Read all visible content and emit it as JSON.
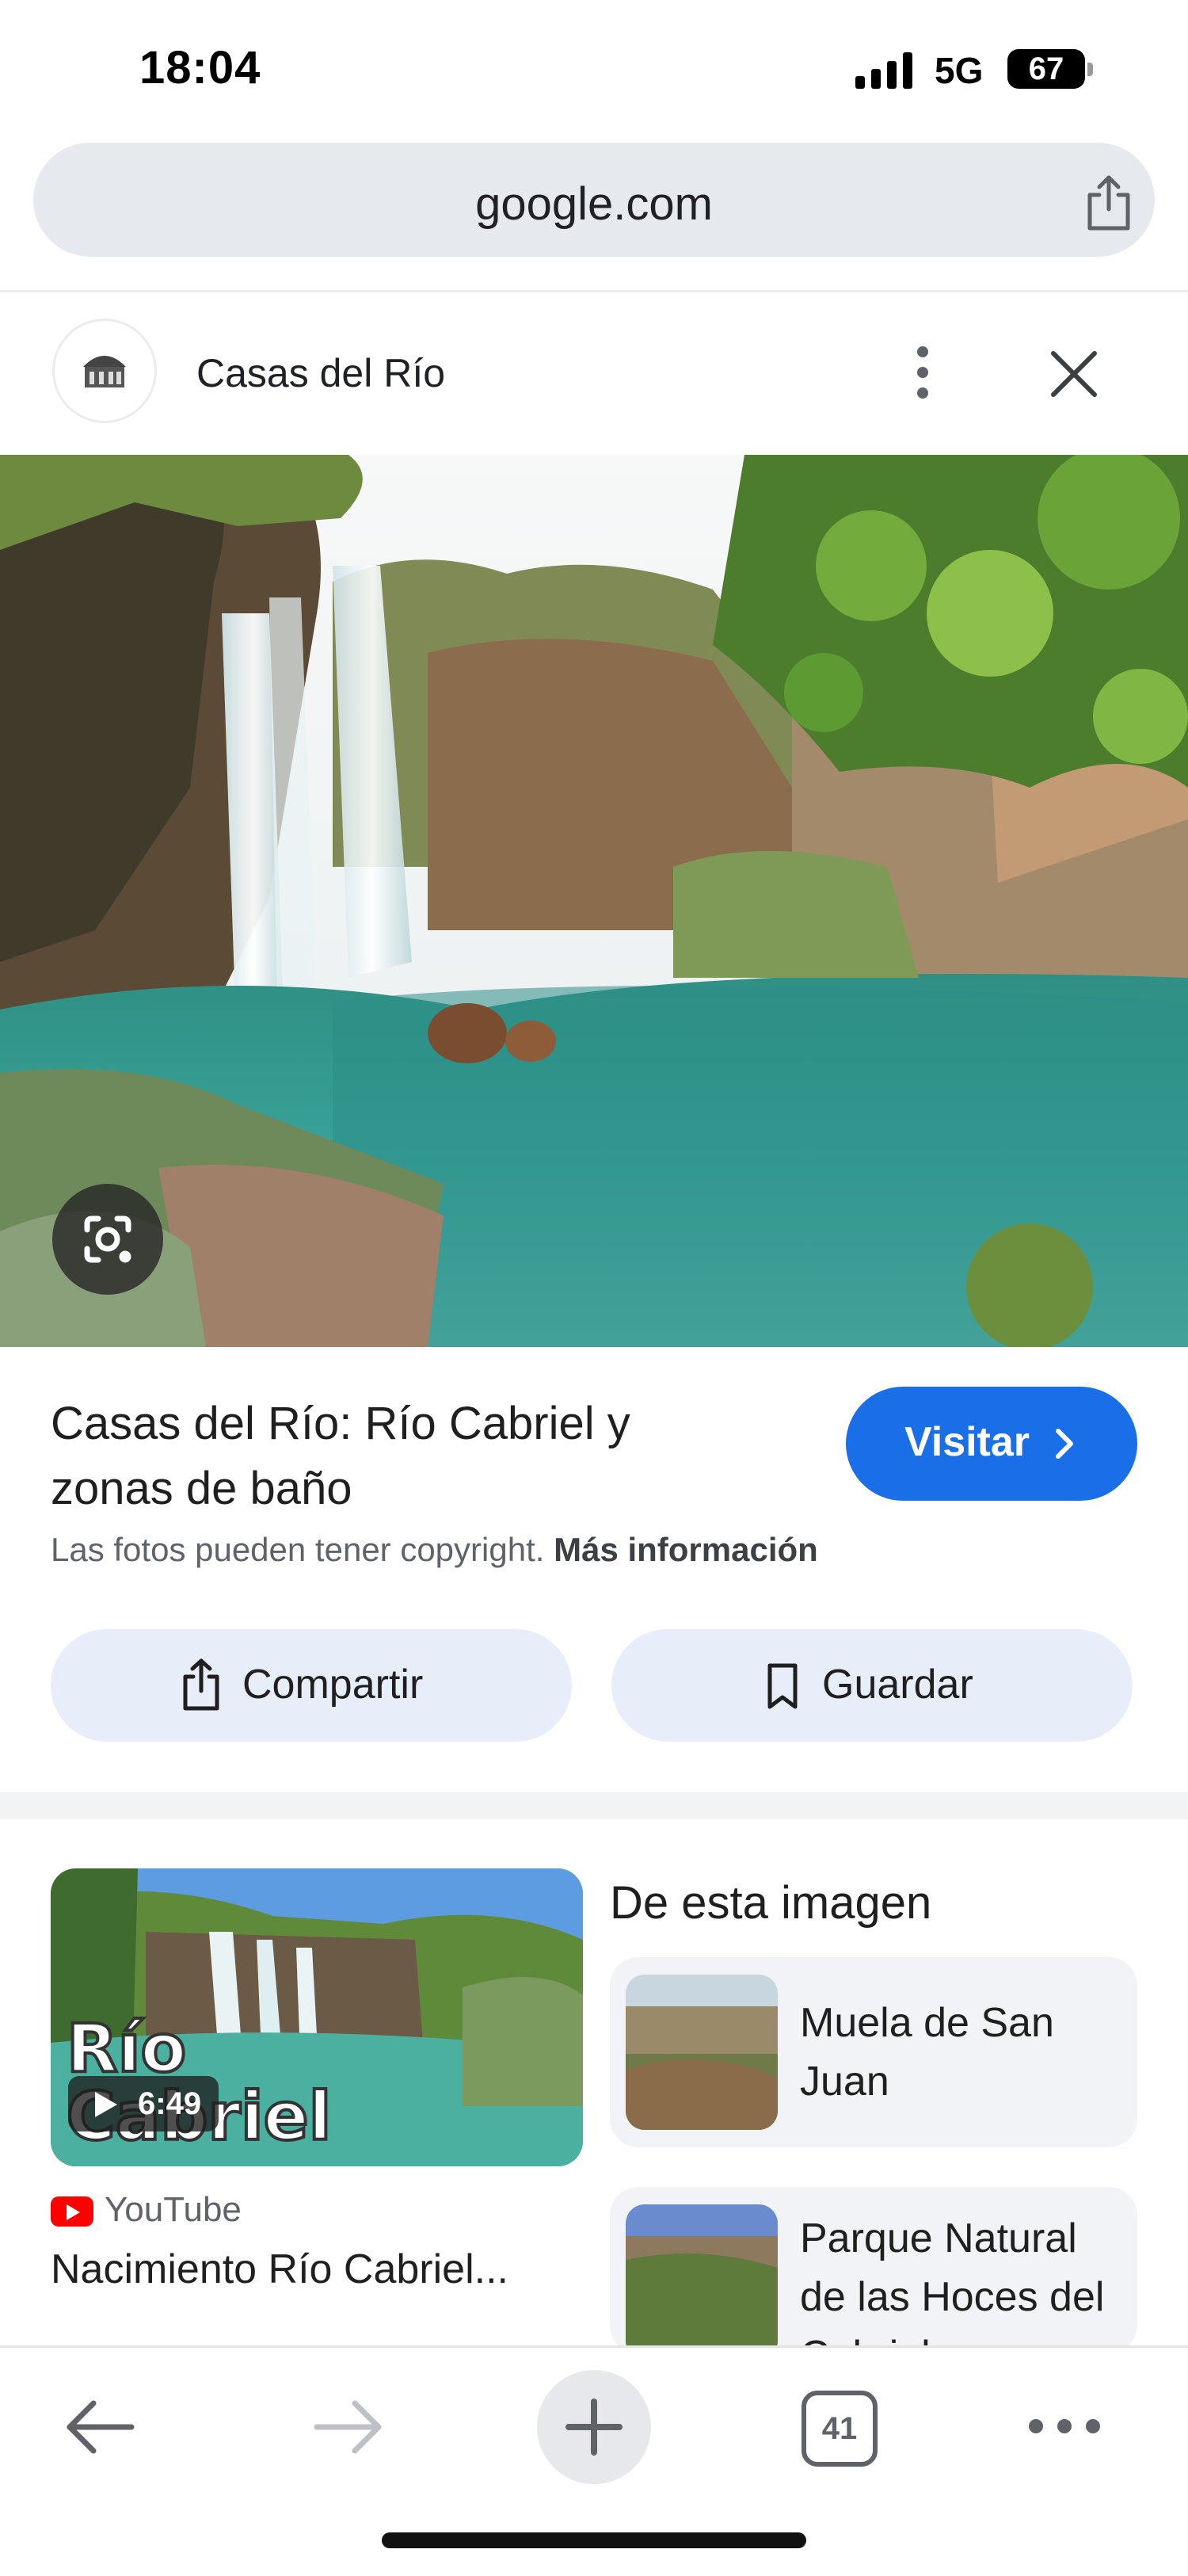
{
  "status_bar": {
    "time": "18:04",
    "network": "5G",
    "battery": "67"
  },
  "browser": {
    "url": "google.com",
    "tab_count": "41"
  },
  "source": {
    "site_name": "Casas del Río"
  },
  "result": {
    "title": "Casas del Río: Río Cabriel y zonas de baño",
    "visit_label": "Visitar",
    "copyright_text": "Las fotos pueden tener copyright.",
    "more_info_label": "Más información",
    "share_label": "Compartir",
    "save_label": "Guardar"
  },
  "video": {
    "thumb_title_line1": "Río",
    "thumb_title_line2": "Cabriel",
    "duration": "6:49",
    "source": "YouTube",
    "title": "Nacimiento Río Cabriel..."
  },
  "related": {
    "heading": "De esta imagen",
    "items": [
      {
        "label": "Muela de San Juan"
      },
      {
        "label": "Parque Natural de las Hoces del Cabriel"
      }
    ]
  },
  "colors": {
    "accent": "#1a6ee8",
    "pill_bg": "#e8eef9",
    "youtube_red": "#ff0000"
  }
}
